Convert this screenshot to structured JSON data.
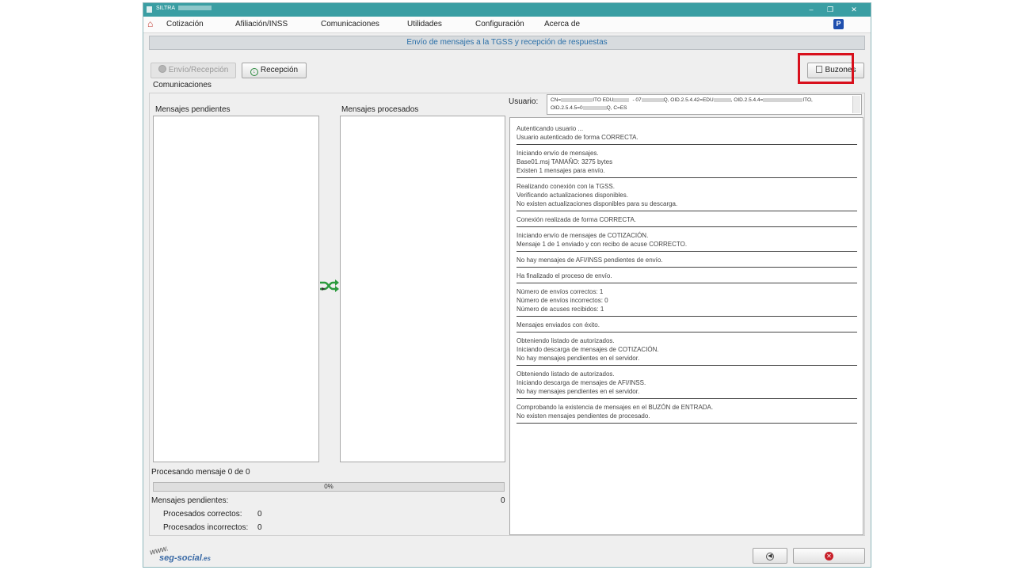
{
  "window": {
    "title": "SILTRA"
  },
  "menu": [
    "Cotización",
    "Afiliación/INSS",
    "Comunicaciones",
    "Utilidades",
    "Configuración",
    "Acerca de"
  ],
  "menu_badge": "P",
  "banner": "Envío de mensajes a la TGSS y recepción de respuestas",
  "toolbar": {
    "envio_recepcion": "Envío/Recepción",
    "recepcion": "Recepción",
    "buzones": "Buzones"
  },
  "labels": {
    "comunicaciones": "Comunicaciones",
    "pendientes_header": "Mensajes pendientes",
    "procesados_header": "Mensajes procesados",
    "usuario": "Usuario:",
    "procesando": "Procesando mensaje 0 de 0",
    "mensajes_pendientes": "Mensajes pendientes:",
    "mensajes_pendientes_val": "0",
    "procesados_correctos": "Procesados correctos:",
    "procesados_correctos_val": "0",
    "procesados_incorrectos": "Procesados incorrectos:",
    "procesados_incorrectos_val": "0"
  },
  "usuario": {
    "line1_a": "CN=",
    "line1_b": "ITO EDU",
    "line1_c": "- 07",
    "line1_d": "Q, OID.2.5.4.42=EDU",
    "line1_e": ", OID.2.5.4.4=",
    "line1_f": "ITO,",
    "line2_a": "OID.2.5.4.5=0",
    "line2_b": "Q, C=ES"
  },
  "progress": {
    "value": 0,
    "text": "0%"
  },
  "log": [
    [
      "Autenticando usuario ...",
      "Usuario autenticado de forma CORRECTA."
    ],
    [
      "Iniciando envío de mensajes.",
      "Base01.msj TAMAÑO: 3275 bytes",
      "Existen 1 mensajes para envío."
    ],
    [
      "Realizando conexión con la TGSS.",
      "Verificando actualizaciones disponibles.",
      "No existen actualizaciones disponibles para su descarga."
    ],
    [
      "Conexión realizada de forma CORRECTA."
    ],
    [
      "Iniciando envío de mensajes de COTIZACIÓN.",
      "Mensaje 1 de 1 enviado y con recibo de acuse CORRECTO."
    ],
    [
      "No hay mensajes de AFI/INSS pendientes de envío."
    ],
    [
      "Ha finalizado el proceso de envío."
    ],
    [
      "Número de envíos correctos: 1",
      "Número de envíos incorrectos: 0",
      "Número de acuses recibidos: 1"
    ],
    [
      "Mensajes enviados con éxito."
    ],
    [
      "Obteniendo listado de autorizados.",
      "Iniciando descarga de mensajes de COTIZACIÓN.",
      "No hay mensajes pendientes en el servidor."
    ],
    [
      "Obteniendo listado de autorizados.",
      "Iniciando descarga de mensajes de AFI/INSS.",
      "No hay mensajes pendientes en el servidor."
    ],
    [
      "Comprobando la existencia de mensajes en el BUZÓN de ENTRADA.",
      "No existen mensajes pendientes de procesado."
    ]
  ],
  "logo": {
    "www": "www.",
    "name": "seg-social",
    "tld": ".es"
  },
  "colors": {
    "titlebar": "#3a9ea3",
    "highlight": "#d8101c",
    "banner_text": "#2a6fa8",
    "close_icon": "#c8202a"
  }
}
